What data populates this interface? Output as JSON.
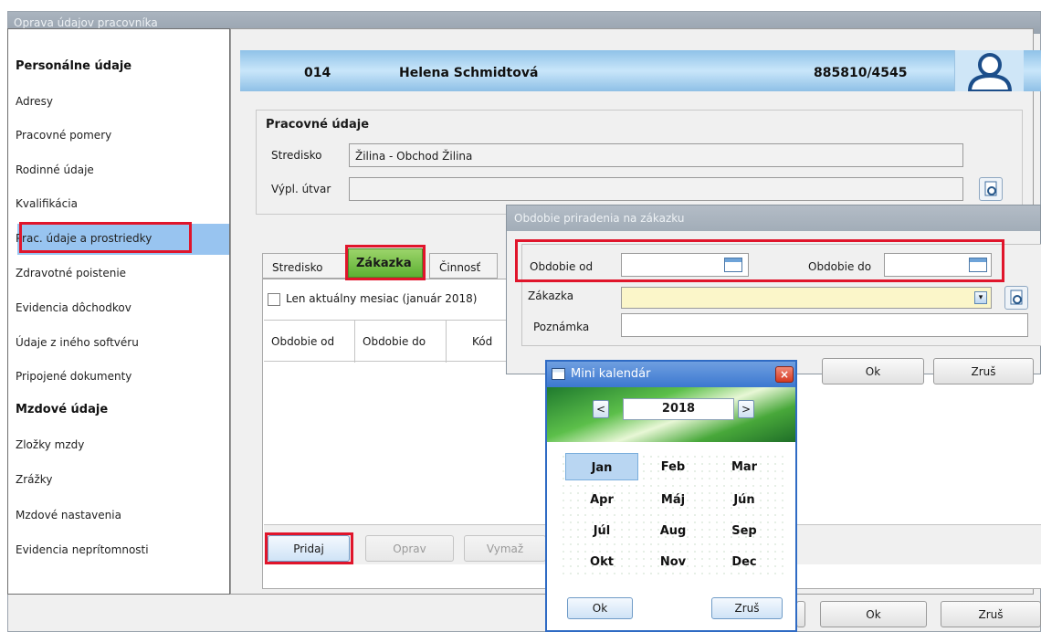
{
  "main_window": {
    "title": "Oprava údajov pracovníka"
  },
  "nav": {
    "sections": [
      {
        "heading": "Personálne údaje",
        "items": [
          "Adresy",
          "Pracovné pomery",
          "Rodinné údaje",
          "Kvalifikácia",
          "Prac. údaje a prostriedky",
          "Zdravotné poistenie",
          "Evidencia dôchodkov",
          "Údaje z iného softvéru",
          "Pripojené dokumenty"
        ]
      },
      {
        "heading": "Mzdové údaje",
        "items": [
          "Zložky mzdy",
          "Zrážky",
          "Mzdové nastavenia",
          "Evidencia neprítomnosti"
        ]
      }
    ],
    "selected_item": "Prac. údaje a prostriedky"
  },
  "employee": {
    "number": "014",
    "name": "Helena Schmidtová",
    "id_number": "885810/4545",
    "avatar_icon": "user-avatar-icon"
  },
  "work_data": {
    "title": "Pracovné údaje",
    "stredisko_label": "Stredisko",
    "stredisko_value": "Žilina - Obchod Žilina",
    "utvar_label": "Výpl. útvar",
    "utvar_value": ""
  },
  "tabs": {
    "items": [
      "Stredisko",
      "Zákazka",
      "Činnosť"
    ],
    "active": "Zákazka"
  },
  "filter": {
    "current_month_label": "Len aktuálny mesiac (január 2018)",
    "checked": false
  },
  "grid": {
    "columns": [
      "Obdobie od",
      "Obdobie do",
      "Kód"
    ]
  },
  "buttons": {
    "add": "Pridaj",
    "edit": "Oprav",
    "delete": "Vymaž",
    "ok": "Ok",
    "cancel": "Zruš"
  },
  "period_dialog": {
    "title": "Obdobie priradenia na zákazku",
    "from_label": "Obdobie od",
    "to_label": "Obdobie do",
    "order_label": "Zákazka",
    "note_label": "Poznámka",
    "ok": "Ok",
    "cancel": "Zruš"
  },
  "mini_calendar": {
    "title": "Mini kalendár",
    "year": "2018",
    "months": [
      "Jan",
      "Feb",
      "Mar",
      "Apr",
      "Máj",
      "Jún",
      "Júl",
      "Aug",
      "Sep",
      "Okt",
      "Nov",
      "Dec"
    ],
    "selected_month": "Jan",
    "ok": "Ok",
    "cancel": "Zruš",
    "close_symbol": "×",
    "prev_symbol": "<",
    "next_symbol": ">"
  },
  "colors": {
    "highlight_red": "#e0152b",
    "header_blue": "#8fc2e8",
    "active_tab_green": "#5db033",
    "selection_blue": "#98c4f0"
  }
}
